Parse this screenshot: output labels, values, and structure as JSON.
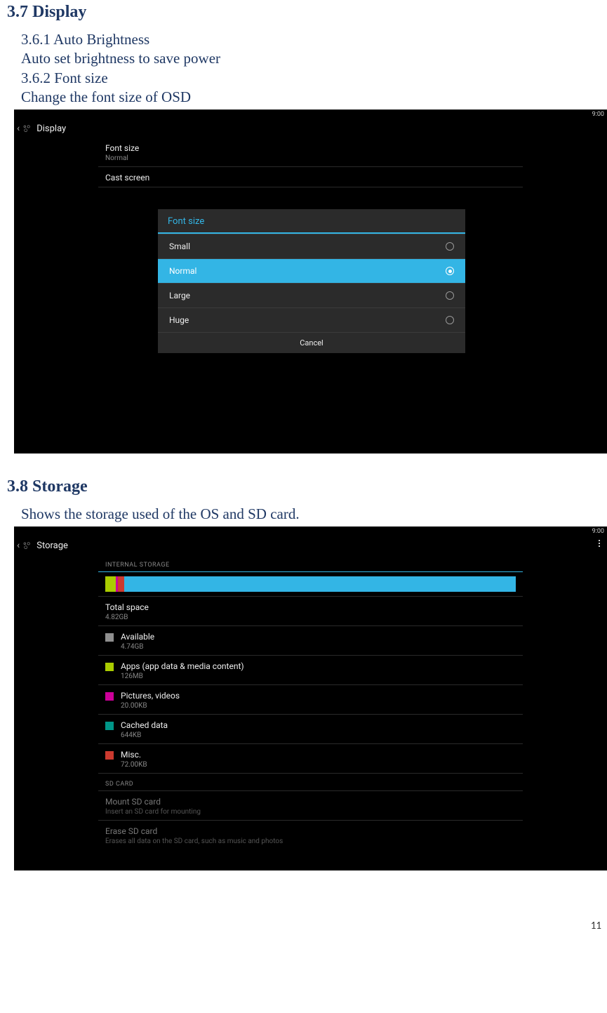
{
  "doc": {
    "section_display_heading": "3.7 Display",
    "line_361": "3.6.1 Auto Brightness",
    "line_autob": "Auto set brightness to save power",
    "line_362": "3.6.2 Font size",
    "line_osd": "Change the font size of OSD",
    "section_storage_heading": "3.8 Storage",
    "line_storage": "Shows the storage used of the OS and SD card.",
    "page_number": "11"
  },
  "display_shot": {
    "status_time": "9:00",
    "action_bar_title": "Display",
    "rows": [
      {
        "title": "Font size",
        "sub": "Normal"
      },
      {
        "title": "Cast screen",
        "sub": ""
      }
    ],
    "dialog": {
      "title": "Font size",
      "options": [
        "Small",
        "Normal",
        "Large",
        "Huge"
      ],
      "selected_index": 1,
      "cancel": "Cancel"
    }
  },
  "storage_shot": {
    "status_time": "9:00",
    "action_bar_title": "Storage",
    "section_internal": "INTERNAL STORAGE",
    "total": {
      "title": "Total space",
      "sub": "4.82GB"
    },
    "items": [
      {
        "title": "Available",
        "sub": "4.74GB",
        "color": "#8f8f8f"
      },
      {
        "title": "Apps (app data & media content)",
        "sub": "126MB",
        "color": "#aacc00"
      },
      {
        "title": "Pictures, videos",
        "sub": "20.00KB",
        "color": "#cc0099"
      },
      {
        "title": "Cached data",
        "sub": "644KB",
        "color": "#009688"
      },
      {
        "title": "Misc.",
        "sub": "72.00KB",
        "color": "#cc3a2f"
      }
    ],
    "usage_segments": [
      {
        "color": "#aacc00",
        "pct": 2.6
      },
      {
        "color": "#cc0099",
        "pct": 0.5
      },
      {
        "color": "#cc3a2f",
        "pct": 1.5
      }
    ],
    "section_sd": "SD CARD",
    "sd_rows": [
      {
        "title": "Mount SD card",
        "sub": "Insert an SD card for mounting"
      },
      {
        "title": "Erase SD card",
        "sub": "Erases all data on the SD card, such as music and photos"
      }
    ]
  },
  "colors": {
    "holo_blue": "#33b5e5",
    "navy": "#1f3864"
  }
}
